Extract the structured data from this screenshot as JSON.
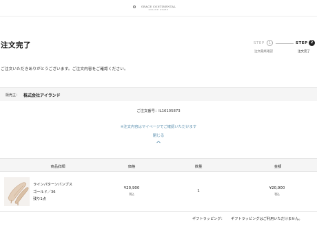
{
  "header": {
    "logo_text": "GRACE CONTINENTAL",
    "logo_sub": "ONLINE STORE"
  },
  "page": {
    "title": "注文完了",
    "thanks_message": "ご注文いただきありがとうございます。ご注文内容をご確認ください。"
  },
  "steps": {
    "step1_label": "STEP",
    "step1_num": "1",
    "step1_caption": "注文最終確認",
    "step2_label": "STEP",
    "step2_num": "2",
    "step2_caption": "注文完了"
  },
  "seller": {
    "label": "販売主：",
    "name": "株式会社アイランド"
  },
  "order": {
    "number_text": "ご注文番号：IL16105873",
    "mypage_note": "※注文内容はマイページでご確認いただけます",
    "close_label": "閉じる"
  },
  "table": {
    "headers": [
      "商品詳細",
      "価格",
      "数量",
      "金額"
    ]
  },
  "product": {
    "name": "ラインパターンパンプス",
    "color_size": "ゴールド／36",
    "stock": "残り1点",
    "price": "¥20,900",
    "price_tax": "税込",
    "quantity": "1",
    "amount": "¥20,900",
    "amount_tax": "税込"
  },
  "gift": {
    "label": "ギフトラッピング：",
    "value": "ギフトラッピングはご利用いただけません。"
  },
  "colors": {
    "link": "#5a8fae",
    "table_bg": "#f5f5f5",
    "step_active": "#222222"
  }
}
